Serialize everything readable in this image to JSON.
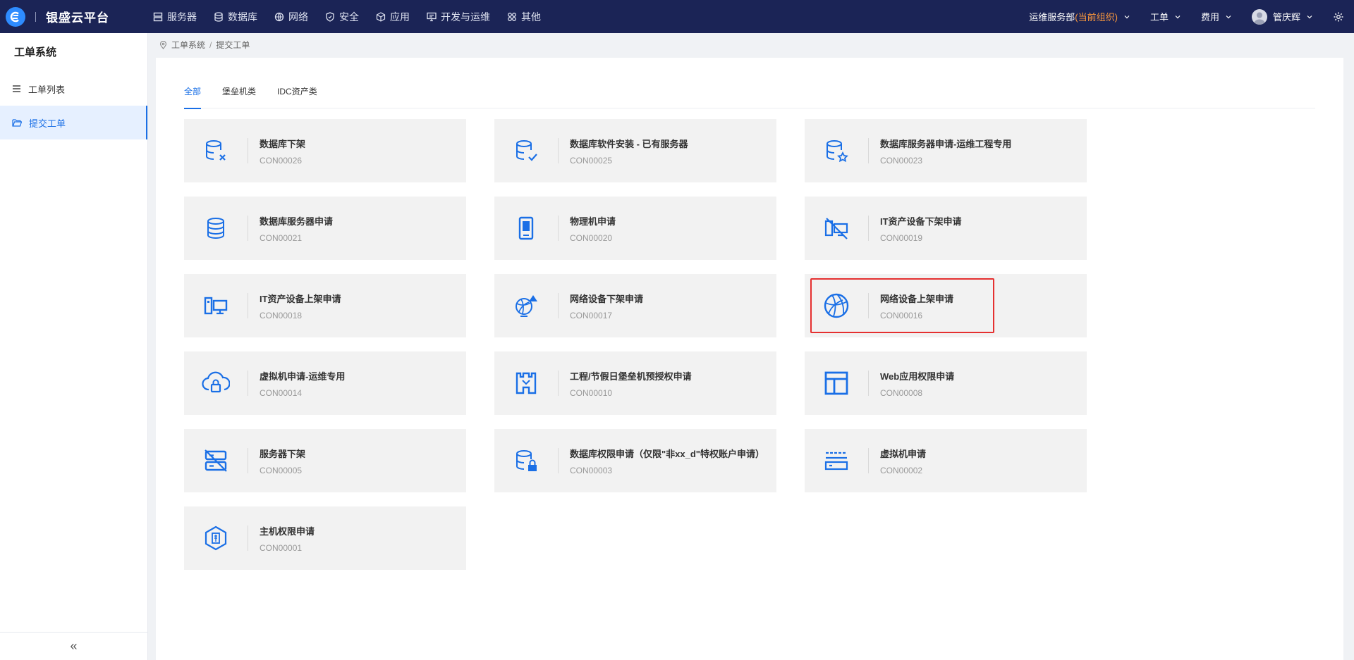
{
  "app": {
    "title": "银盛云平台"
  },
  "nav": [
    {
      "label": "服务器",
      "icon": "server-icon"
    },
    {
      "label": "数据库",
      "icon": "database-icon"
    },
    {
      "label": "网络",
      "icon": "globe-icon"
    },
    {
      "label": "安全",
      "icon": "shield-icon"
    },
    {
      "label": "应用",
      "icon": "cube-icon"
    },
    {
      "label": "开发与运维",
      "icon": "devops-icon"
    },
    {
      "label": "其他",
      "icon": "other-icon"
    }
  ],
  "header_right": {
    "org_name": "运维服务部",
    "org_tag": "(当前组织)",
    "ticket_menu": "工单",
    "cost_menu": "费用",
    "user_name": "管庆辉"
  },
  "sidebar": {
    "title": "工单系统",
    "items": [
      {
        "label": "工单列表",
        "icon": "list-icon",
        "active": false
      },
      {
        "label": "提交工单",
        "icon": "folder-open-icon",
        "active": true
      }
    ],
    "collapse": "«"
  },
  "breadcrumb": {
    "root": "工单系统",
    "separator": "/",
    "current": "提交工单"
  },
  "tabs": [
    {
      "label": "全部",
      "active": true
    },
    {
      "label": "堡垒机类",
      "active": false
    },
    {
      "label": "IDC资产类",
      "active": false
    }
  ],
  "colors": {
    "accent": "#1a6fe6",
    "topbar": "#1b2456",
    "highlight": "#e53030",
    "card_bg": "#f2f2f2"
  },
  "cards": [
    {
      "title": "数据库下架",
      "code": "CON00026",
      "icon": "database-remove-icon"
    },
    {
      "title": "数据库软件安装 - 已有服务器",
      "code": "CON00025",
      "icon": "database-check-icon"
    },
    {
      "title": "数据库服务器申请-运维工程专用",
      "code": "CON00023",
      "icon": "database-star-icon"
    },
    {
      "title": "数据库服务器申请",
      "code": "CON00021",
      "icon": "database-icon"
    },
    {
      "title": "物理机申请",
      "code": "CON00020",
      "icon": "physical-machine-icon"
    },
    {
      "title": "IT资产设备下架申请",
      "code": "CON00019",
      "icon": "device-offline-icon"
    },
    {
      "title": "IT资产设备上架申请",
      "code": "CON00018",
      "icon": "desktop-device-icon"
    },
    {
      "title": "网络设备下架申请",
      "code": "CON00017",
      "icon": "network-device-remove-icon"
    },
    {
      "title": "网络设备上架申请",
      "code": "CON00016",
      "icon": "network-globe-icon",
      "highlighted": true
    },
    {
      "title": "虚拟机申请-运维专用",
      "code": "CON00014",
      "icon": "cloud-lock-icon"
    },
    {
      "title": "工程/节假日堡垒机预授权申请",
      "code": "CON00010",
      "icon": "bastion-icon"
    },
    {
      "title": "Web应用权限申请",
      "code": "CON00008",
      "icon": "layout-icon"
    },
    {
      "title": "服务器下架",
      "code": "CON00005",
      "icon": "server-off-icon"
    },
    {
      "title": "数据库权限申请（仅限\"非xx_d\"特权账户申请）",
      "code": "CON00003",
      "icon": "database-lock-icon"
    },
    {
      "title": "虚拟机申请",
      "code": "CON00002",
      "icon": "virtual-machine-icon"
    },
    {
      "title": "主机权限申请",
      "code": "CON00001",
      "icon": "host-permission-icon"
    }
  ]
}
